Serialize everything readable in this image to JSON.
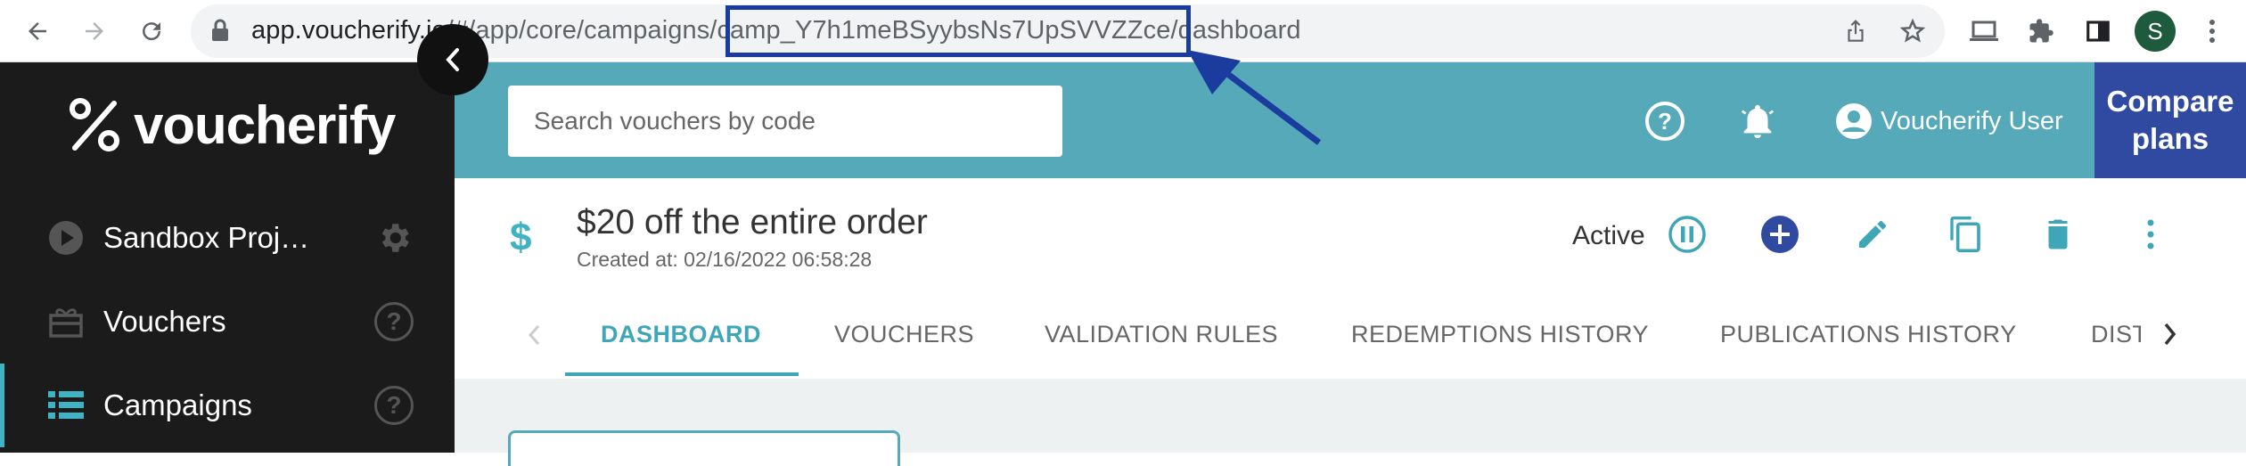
{
  "browser": {
    "url_host": "app.voucherify.io",
    "url_path_pre": "/#/app/core/campaigns/",
    "url_campaign_id": "camp_Y7h1meBSyybsNs7UpSVVZZce",
    "url_path_post": "/dashboard",
    "avatar_letter": "S"
  },
  "sidebar": {
    "logo_text": "voucherify",
    "items": [
      {
        "label": "Sandbox Proj…"
      },
      {
        "label": "Vouchers"
      },
      {
        "label": "Campaigns"
      }
    ]
  },
  "header": {
    "search_placeholder": "Search vouchers by code",
    "user_name": "Voucherify User",
    "compare_line1": "Compare",
    "compare_line2": "plans"
  },
  "campaign": {
    "currency_symbol": "$",
    "title": "$20 off the entire order",
    "created": "Created at: 02/16/2022 06:58:28",
    "status": "Active"
  },
  "tabs": [
    {
      "label": "DASHBOARD"
    },
    {
      "label": "VOUCHERS"
    },
    {
      "label": "VALIDATION RULES"
    },
    {
      "label": "REDEMPTIONS HISTORY"
    },
    {
      "label": "PUBLICATIONS HISTORY"
    },
    {
      "label": "DIST"
    }
  ],
  "colors": {
    "header_teal": "#55a9b9",
    "accent": "#3fa6b8",
    "compare_blue": "#2f4aa0",
    "highlight_blue": "#1a3c9e",
    "sidebar_bg": "#1b1b1b"
  },
  "icons": [
    "back-icon",
    "forward-icon",
    "reload-icon",
    "lock-icon",
    "share-icon",
    "star-icon",
    "cast-icon",
    "extensions-icon",
    "sidepanel-icon",
    "menu-icon",
    "help-icon",
    "bell-icon",
    "user-icon",
    "gear-icon",
    "play-icon",
    "gift-icon",
    "list-icon",
    "pause-icon",
    "plus-icon",
    "edit-icon",
    "copy-icon",
    "delete-icon",
    "more-icon",
    "chevron-left-icon",
    "chevron-right-icon"
  ]
}
